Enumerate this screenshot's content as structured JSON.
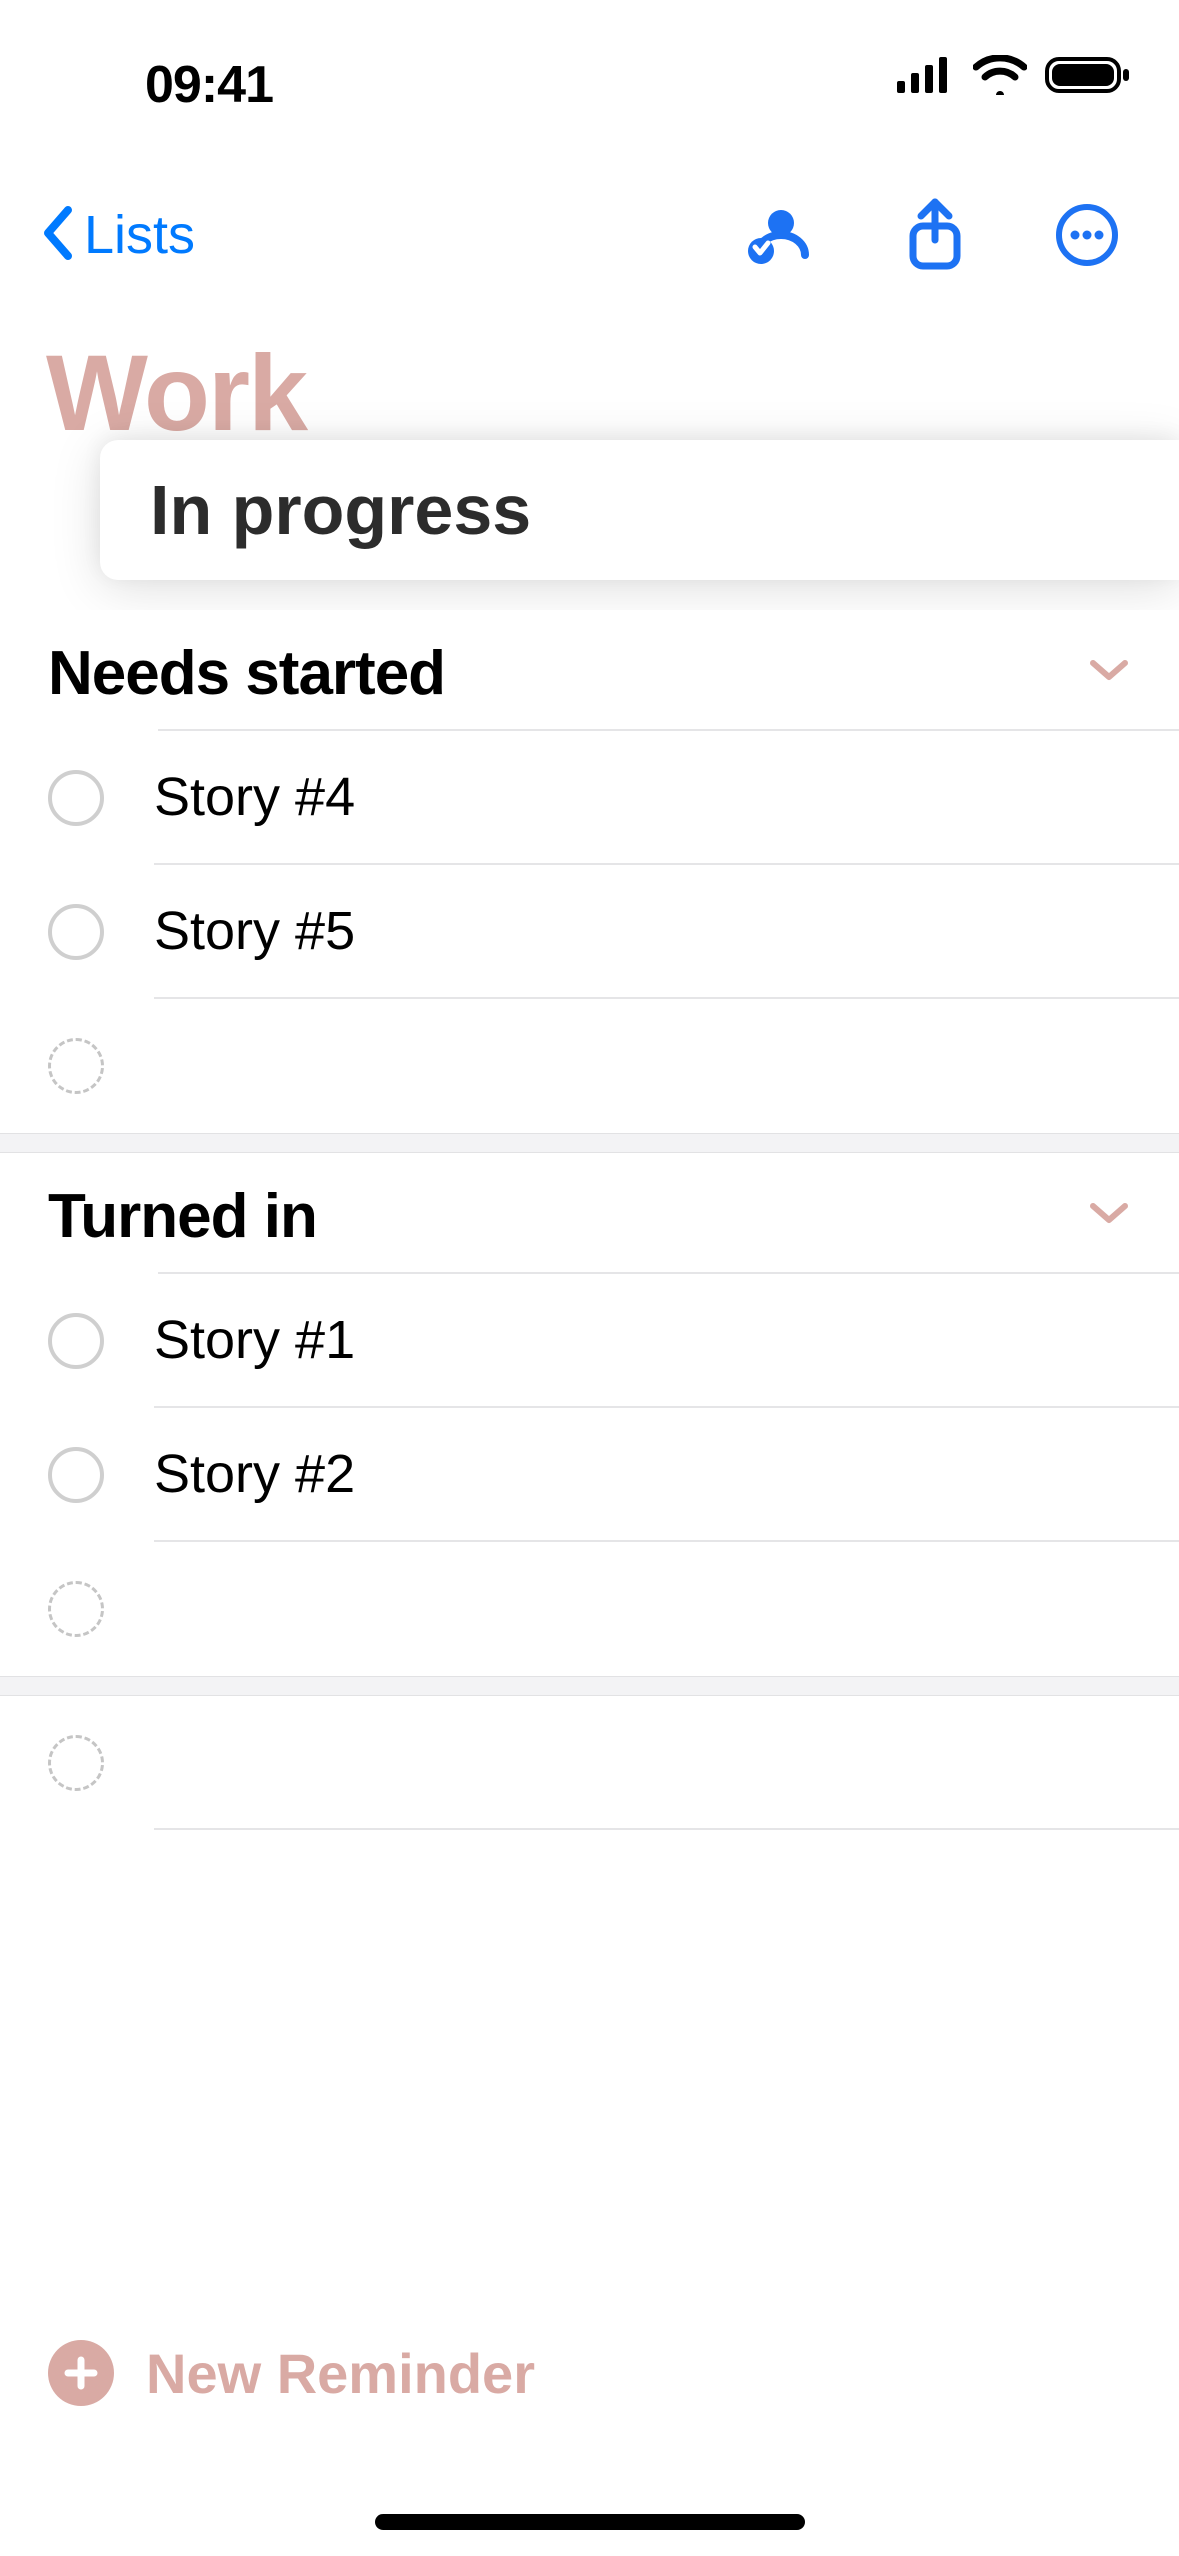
{
  "status": {
    "time": "09:41"
  },
  "nav": {
    "back_label": "Lists"
  },
  "list": {
    "title": "Work",
    "active_column": "In progress",
    "sections": [
      {
        "title": "Needs started",
        "items": [
          "Story #4",
          "Story #5"
        ]
      },
      {
        "title": "Turned in",
        "items": [
          "Story #1",
          "Story #2"
        ]
      }
    ]
  },
  "footer": {
    "new_reminder_label": "New Reminder"
  }
}
